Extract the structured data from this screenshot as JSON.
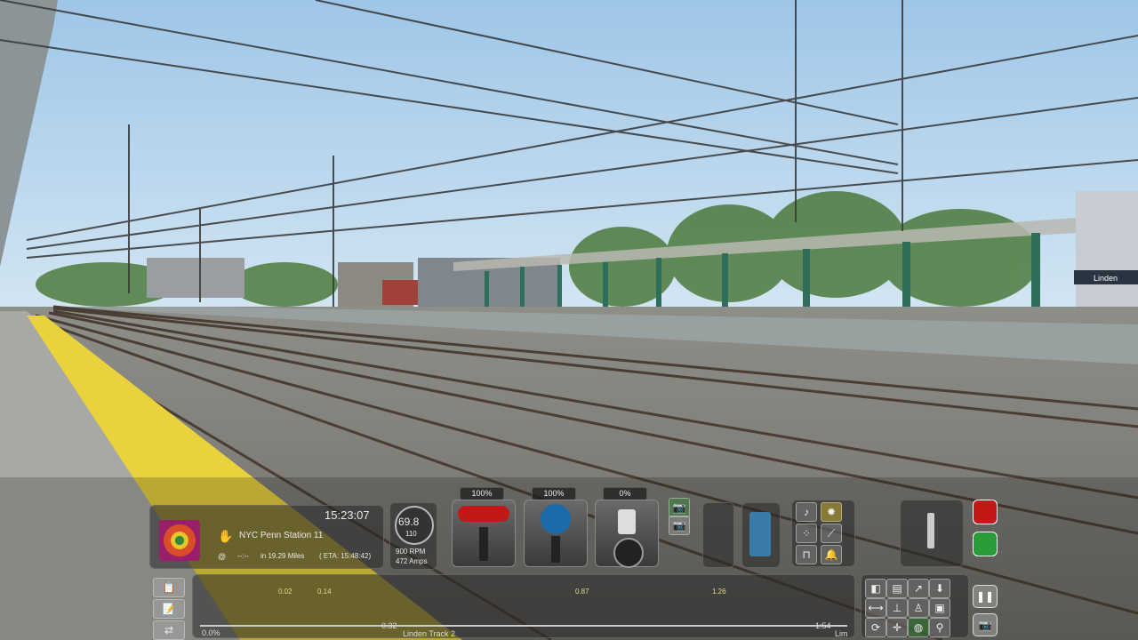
{
  "hud": {
    "clock": "15:23:07",
    "speed": "69.8",
    "speed_limit": "110",
    "rpm": "900 RPM",
    "amps": "472 Amps",
    "next_station": "NYC Penn Station 11",
    "next_stop_dash": "--:--",
    "distance": "in 19.29 Miles",
    "eta": "( ETA: 15:48:42)",
    "throttle_pct": "100%",
    "brake_pct": "100%",
    "reverser_pct": "0%",
    "track_name": "Linden Track 2",
    "station_sign": "Linden",
    "track_ticks": [
      "0.02",
      "0.14",
      "0.87",
      "1.26"
    ],
    "track_scale_start": "0.0%",
    "track_scale_mid": "0.32",
    "track_scale_end": "1:54",
    "track_scale_unit": "Lim"
  },
  "icons": {
    "compass": "compass-icon",
    "hand": "hand-icon",
    "camera": "camera-icon",
    "pause": "pause-icon",
    "emergency": "emergency-brake-icon"
  },
  "colors": {
    "sky": "#a9cdea",
    "platform_stripe": "#e9d23c",
    "throttle_red": "#c41818",
    "brake_blue": "#1d6aa8"
  }
}
